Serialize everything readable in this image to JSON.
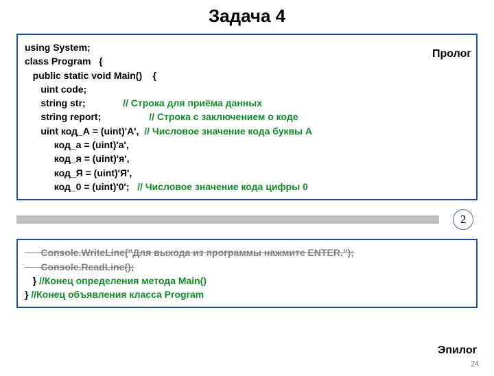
{
  "title": "Задача 4",
  "prolog_label": "Пролог",
  "epilog_label": "Эпилог",
  "divider_number": "2",
  "page_number": "24",
  "prolog": {
    "l1": "using System;",
    "l2": "class Program   {",
    "l3": "   public static void Main()    {",
    "l4": "      uint code;",
    "l5a": "      string str;              ",
    "l5b": "// Строка для приёма данных",
    "l6a": "      string report;                  ",
    "l6b": "// Строка с заключением о коде",
    "l7a": "      uint код_А = (uint)'А',  ",
    "l7b": "// Числовое значение кода буквы А",
    "l8": "           код_а = (uint)'а',",
    "l9": "           код_я = (uint)'я',",
    "l10": "           код_Я = (uint)'Я',",
    "l11a": "           код_0 = (uint)'0';   ",
    "l11b": "// Числовое значение кода цифры 0"
  },
  "epilog": {
    "l1": "      Console.WriteLine(\"Для выхода из программы нажмите ENTER.\");",
    "l2": "      Console.ReadLine();",
    "l3a": "   } ",
    "l3b": "//Конец определения метода Main()",
    "l4a": "} ",
    "l4b": "//Конец объявления класса Program"
  }
}
